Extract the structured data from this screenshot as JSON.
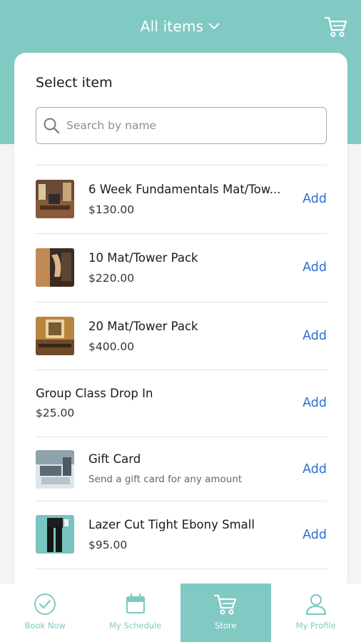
{
  "header": {
    "title": "All items",
    "cart_icon": "cart-icon",
    "dropdown_icon": "chevron-down-icon"
  },
  "card": {
    "title": "Select item",
    "search": {
      "placeholder": "Search by name",
      "value": ""
    }
  },
  "items": [
    {
      "name": "6 Week Fundamentals Mat/Tow...",
      "price": "$130.00",
      "action": "Add",
      "has_thumb": true
    },
    {
      "name": "10 Mat/Tower Pack",
      "price": "$220.00",
      "action": "Add",
      "has_thumb": true
    },
    {
      "name": "20 Mat/Tower Pack",
      "price": "$400.00",
      "action": "Add",
      "has_thumb": true
    },
    {
      "name": "Group Class Drop In",
      "price": "$25.00",
      "action": "Add",
      "has_thumb": false
    },
    {
      "name": "Gift Card",
      "subtitle": "Send a gift card for any amount",
      "action": "Add",
      "has_thumb": true
    },
    {
      "name": "Lazer Cut Tight Ebony Small",
      "price": "$95.00",
      "action": "Add",
      "has_thumb": true
    }
  ],
  "tabbar": {
    "tabs": [
      {
        "label": "Book Now",
        "icon": "check-circle-icon",
        "active": false
      },
      {
        "label": "My Schedule",
        "icon": "calendar-icon",
        "active": false
      },
      {
        "label": "Store",
        "icon": "cart-icon",
        "active": true
      },
      {
        "label": "My Profile",
        "icon": "profile-icon",
        "active": false
      }
    ]
  },
  "colors": {
    "brand_teal": "#80cac3",
    "add_link": "#2f6ed2",
    "background": "#f4f4f4"
  }
}
